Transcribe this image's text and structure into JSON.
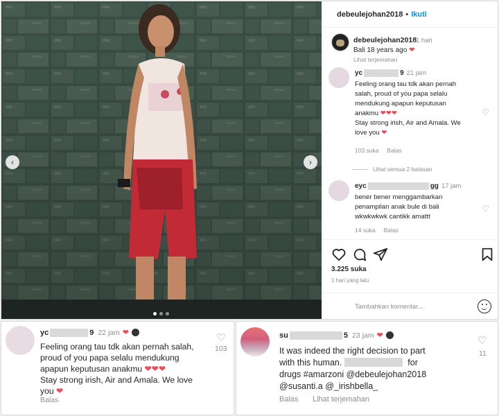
{
  "post": {
    "header": {
      "username": "debeulejohan2018",
      "separator": "•",
      "follow_label": "Ikuti"
    },
    "photo": {
      "dots": 3,
      "active_dot": 0,
      "prev_icon": "chevron-left-icon",
      "next_icon": "chevron-right-icon"
    },
    "caption": {
      "username": "debeulejohan2018",
      "time": "1 hari",
      "text": "Bali 18 years ago",
      "emoji": "❤",
      "translate_label": "Lihat terjemahan"
    },
    "comments": [
      {
        "user_prefix": "yc",
        "user_suffix": "9",
        "time": "21 jam",
        "text_line1": "Feeling orang tau tdk akan pernah",
        "text_line2": "salah, proud of you papa selalu",
        "text_line3": "mendukung apapun keputusan",
        "text_line4": "anakmu ❤❤❤",
        "text_line5": "Stay strong irish, Air and Amala. We",
        "text_line6": "love you ❤",
        "likes": "103 suka",
        "reply_label": "Balas"
      },
      {
        "user_prefix": "eyc",
        "user_suffix": "gg",
        "time": "17 jam",
        "text_line1": "bener bener menggambarkan",
        "text_line2": "penampilan anak bule di bali",
        "text_line3": "wkwkwkwk cantikk amattt",
        "likes": "14 suka",
        "reply_label": "Balas"
      }
    ],
    "view_replies_label": "Lihat semua 2 balasan",
    "likes_count": "3.225 suka",
    "posted_time": "1 hari yang lalu",
    "comment_placeholder": "Tambahkan komentar...",
    "icons": [
      "heart-icon",
      "comment-icon",
      "share-icon",
      "bookmark-icon",
      "emoji-icon"
    ]
  },
  "bottom_left": {
    "user_prefix": "yc",
    "user_suffix": "9",
    "time": "22 jam",
    "line1": "Feeling orang tau tdk akan pernah salah,",
    "line2": "proud of you papa selalu mendukung",
    "line3": "apapun keputusan anakmu ❤❤❤",
    "line4": "Stay strong irish, Air and Amala. We love",
    "line5": "you ❤",
    "reply_label": "Balas",
    "like_count": "103"
  },
  "bottom_right": {
    "user_prefix": "su",
    "user_suffix": "5",
    "time": "23 jam",
    "line1": "It was indeed the right decision to part",
    "line2": "with this human.",
    "line2b": "for",
    "line3": "drugs #amarzoni @debeulejohan2018",
    "line4": "@susanti.a @_irishbella_",
    "reply_label": "Balas",
    "translate_label": "Lihat terjemahan",
    "like_count": "11"
  },
  "colors": {
    "link_blue": "#0095f6",
    "heart_red": "#ed4956",
    "muted": "#8e8e8e",
    "border": "#dbdbdb"
  }
}
